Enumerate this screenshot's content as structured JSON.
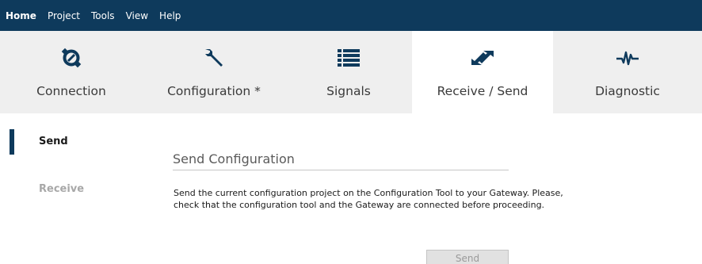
{
  "menu": {
    "items": [
      {
        "label": "Home",
        "active": true
      },
      {
        "label": "Project",
        "active": false
      },
      {
        "label": "Tools",
        "active": false
      },
      {
        "label": "View",
        "active": false
      },
      {
        "label": "Help",
        "active": false
      }
    ]
  },
  "ribbon": {
    "tabs": [
      {
        "label": "Connection",
        "icon": "connection-icon",
        "active": false
      },
      {
        "label": "Configuration *",
        "icon": "wrench-icon",
        "active": false
      },
      {
        "label": "Signals",
        "icon": "list-icon",
        "active": false
      },
      {
        "label": "Receive / Send",
        "icon": "transfer-arrows-icon",
        "active": true
      },
      {
        "label": "Diagnostic",
        "icon": "waveform-icon",
        "active": false
      }
    ]
  },
  "nav": {
    "items": [
      {
        "label": "Send",
        "selected": true
      },
      {
        "label": "Receive",
        "selected": false
      }
    ]
  },
  "content": {
    "title": "Send Configuration",
    "description": "Send the current configuration project on the Configuration Tool to your Gateway. Please, check that the configuration tool and the Gateway are connected before proceeding.",
    "send_button": "Send"
  },
  "colors": {
    "brand": "#0e3a5c",
    "ribbon_bg": "#efefef",
    "active_tab_bg": "#ffffff",
    "disabled_text": "#a8a8a8"
  }
}
